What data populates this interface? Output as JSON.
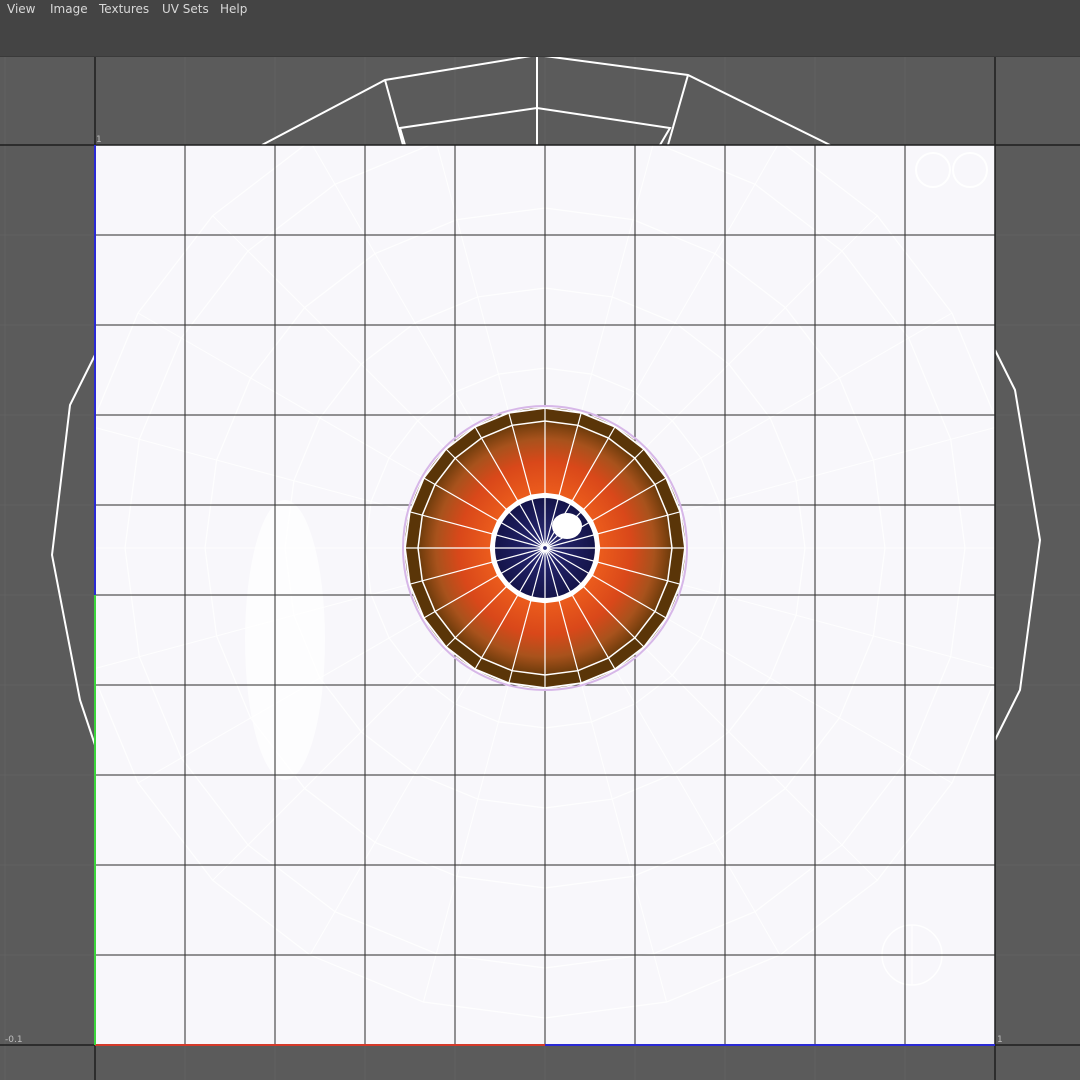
{
  "menu": {
    "items": [
      {
        "label": "View"
      },
      {
        "label": "Image"
      },
      {
        "label": "Textures"
      },
      {
        "label": "UV Sets"
      },
      {
        "label": "Help"
      }
    ]
  },
  "uv_editor": {
    "texture": "eye-iris",
    "tile_label_top_left": "1",
    "tile_label_bottom_left": "-0.1",
    "tile_label_bottom_right": "1",
    "grid_divisions": 10,
    "colors": {
      "background": "#5b5b5b",
      "menubar": "#444444",
      "texture_fill": "#f8f7fb",
      "grid_line": "#2a2a2a",
      "wireframe": "#ffffff",
      "iris_orange": "#e2501a",
      "iris_ring": "#5a3508",
      "pupil": "#1a1a5a",
      "u_axis": "#d43a2a",
      "v_axis": "#3bd43b"
    }
  }
}
